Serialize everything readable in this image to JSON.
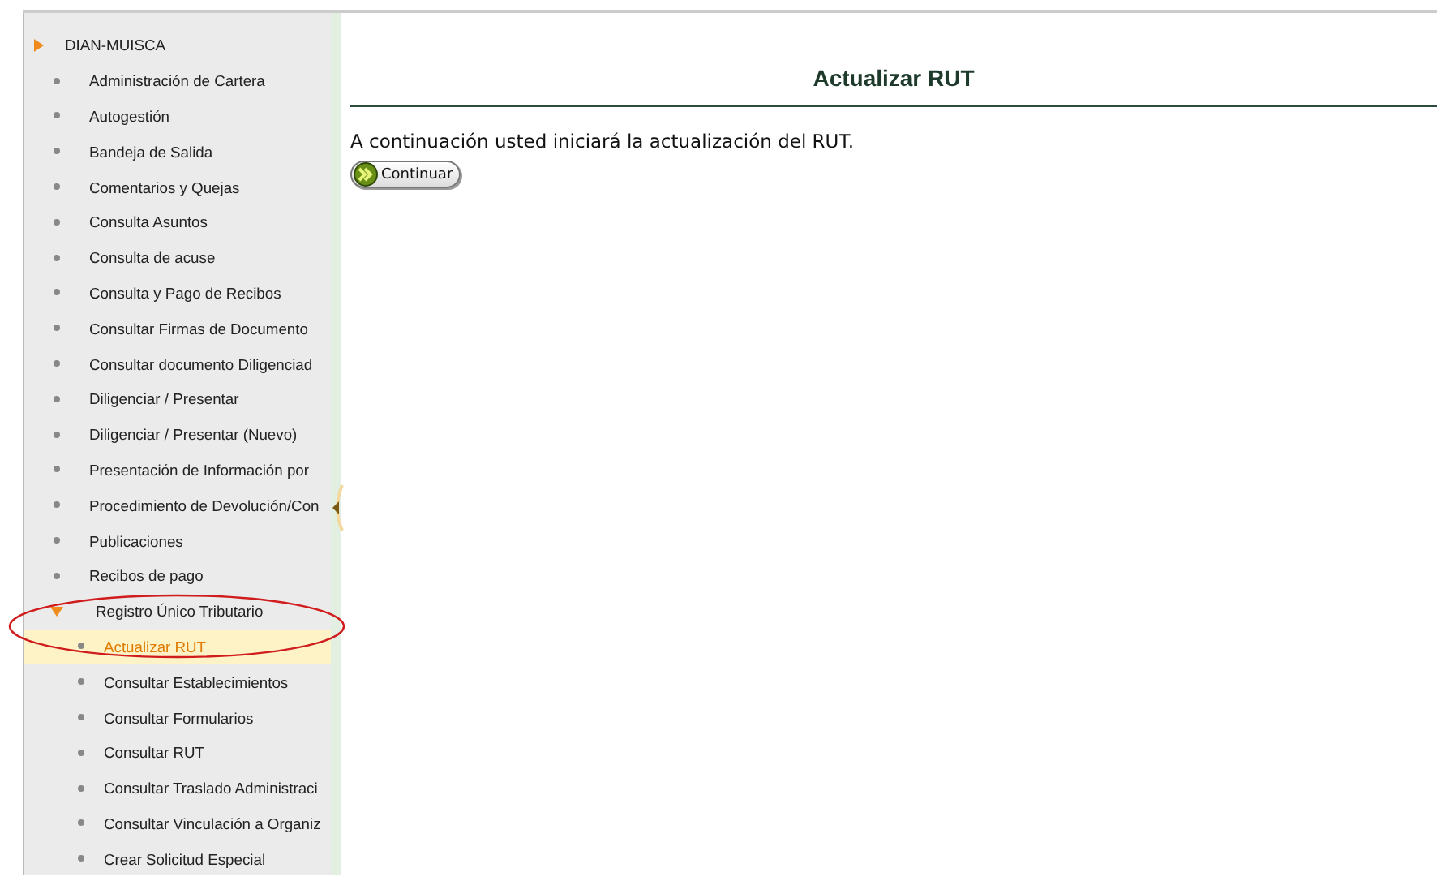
{
  "sidebar": {
    "tree": [
      {
        "label": "DIAN-MUISCA",
        "children": [
          {
            "label": "Administración de Cartera",
            "selected": false
          },
          {
            "label": "Autogestión",
            "selected": false
          },
          {
            "label": "Bandeja de Salida",
            "selected": false
          },
          {
            "label": "Comentarios y Quejas",
            "selected": false
          },
          {
            "label": "Consulta Asuntos",
            "selected": false
          },
          {
            "label": "Consulta de acuse",
            "selected": false
          },
          {
            "label": "Consulta y Pago de Recibos",
            "selected": false
          },
          {
            "label": "Consultar Firmas de Documento",
            "selected": false
          },
          {
            "label": "Consultar documento Diligenciad",
            "selected": false
          },
          {
            "label": "Diligenciar / Presentar",
            "selected": false
          },
          {
            "label": "Diligenciar / Presentar (Nuevo)",
            "selected": false
          },
          {
            "label": "Presentación de Información por",
            "selected": false
          },
          {
            "label": "Procedimiento de Devolución/Con",
            "selected": false
          },
          {
            "label": "Publicaciones",
            "selected": false
          },
          {
            "label": "Recibos de pago",
            "selected": false
          },
          {
            "label": "Registro Único Tributario",
            "expanded": true,
            "children": [
              {
                "label": "Actualizar RUT",
                "selected": true
              },
              {
                "label": "Consultar Establecimientos",
                "selected": false
              },
              {
                "label": "Consultar Formularios",
                "selected": false
              },
              {
                "label": "Consultar RUT",
                "selected": false
              },
              {
                "label": "Consultar Traslado Administraci",
                "selected": false
              },
              {
                "label": "Consultar Vinculación a Organiz",
                "selected": false
              },
              {
                "label": "Crear Solicitud Especial",
                "selected": false
              }
            ]
          }
        ]
      }
    ]
  },
  "main": {
    "title": "Actualizar RUT",
    "message": "A continuación usted iniciará la actualización del RUT.",
    "button": "Continuar"
  }
}
